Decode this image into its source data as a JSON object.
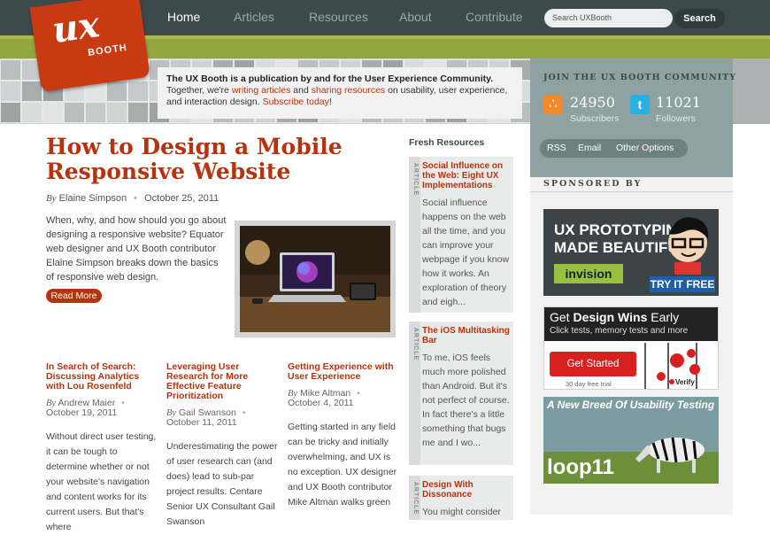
{
  "nav": {
    "items": [
      {
        "label": "Home",
        "active": true
      },
      {
        "label": "Articles"
      },
      {
        "label": "Resources"
      },
      {
        "label": "About"
      },
      {
        "label": "Contribute"
      }
    ],
    "search_placeholder": "Search UXBooth",
    "search_button": "Search"
  },
  "logo": {
    "text_1": "ux",
    "text_2": "BOOTH"
  },
  "intro": {
    "bold": "The UX Booth is a publication by and for the User Experience Community.",
    "text_1": "Together, we're ",
    "link_1": "writing articles",
    "text_2": " and ",
    "link_2": "sharing resources",
    "text_3": " on usability, user experience, and interaction design. ",
    "link_3": "Subscribe today",
    "text_4": "!"
  },
  "featured": {
    "title": "How to Design a Mobile Responsive Website",
    "by": "By",
    "author": "Elaine Simpson",
    "separator": "•",
    "date": "October 25, 2011",
    "excerpt": "When, why, and how should you go about designing a responsive website? Equator web designer and UX Booth contributor Elaine Simpson breaks down the basics of responsive web design.",
    "read_more": "Read More"
  },
  "articles": [
    {
      "title": "In Search of Search: Discussing Analytics with Lou Rosenfeld",
      "by": "By",
      "author": "Andrew Maier",
      "separator": "•",
      "date": "October 19, 2011",
      "excerpt": "Without direct user testing, it can be tough to determine whether or not your website's navigation and content works for its current users. But that's where"
    },
    {
      "title": "Leveraging User Research for More Effective Feature Prioritization",
      "by": "By",
      "author": "Gail Swanson",
      "separator": "•",
      "date": "October 11, 2011",
      "excerpt": "Underestimating the power of user research can (and does) lead to sub-par project results. Centare Senior UX Consultant Gail Swanson"
    },
    {
      "title": "Getting Experience with User Experience",
      "by": "By",
      "author": "Mike Altman",
      "separator": "•",
      "date": "October 4, 2011",
      "excerpt": "Getting started in any field can be tricky and initially overwhelming, and UX is no exception. UX designer and UX Booth contributor Mike Altman walks green"
    }
  ],
  "fresh": {
    "heading": "Fresh Resources",
    "tag": "ARTICLE",
    "items": [
      {
        "title": "Social Influence on the Web: Eight UX Implementations",
        "excerpt": "Social influence happens on the web all the time, and you can improve your webpage if you know how it works. An exploration of theory and eigh..."
      },
      {
        "title": "The iOS Multitasking Bar",
        "excerpt": "To me, iOS feels much more polished than Android. But it's not perfect of course. In fact there's a little something that bugs me and I wo..."
      },
      {
        "title": "Design With Dissonance",
        "excerpt": "You might consider"
      }
    ]
  },
  "sidebar": {
    "join_title": "JOIN THE UX BOOTH COMMUNITY",
    "subscribers_count": "24950",
    "subscribers_label": "Subscribers",
    "followers_count": "11021",
    "followers_label": "Followers",
    "links": [
      "RSS",
      "Email",
      "Other Options"
    ],
    "sponsored_title": "SPONSORED BY",
    "ad1": {
      "line1": "UX PROTOTYPING",
      "line2": "MADE BEAUTIFUL",
      "brand": "invision",
      "cta": "TRY IT FREE"
    },
    "ad2": {
      "title_1": "Get ",
      "title_bold": "Design Wins",
      "title_2": " Early",
      "subtitle": "Click tests, memory tests and more",
      "cta": "Get Started",
      "trial": "30 day free trial",
      "brand": "Verify"
    },
    "ad3": {
      "title": "A New Breed Of Usability Testing",
      "brand": "loop11"
    }
  },
  "colors": {
    "accent": "#b5340e",
    "nav_bg": "#3c4a4c",
    "green_band": "#93a640",
    "sidebar_teal": "#8ea1a3"
  }
}
